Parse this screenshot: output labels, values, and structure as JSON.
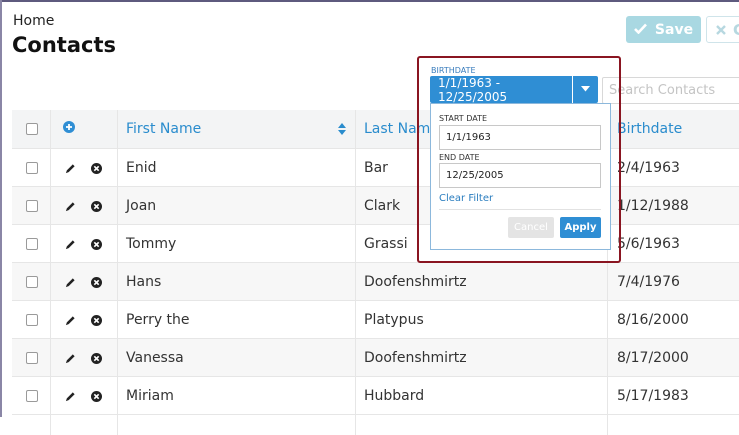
{
  "header": {
    "breadcrumb": "Home",
    "title": "Contacts",
    "save_label": "Save",
    "cancel_label": "C",
    "save_icon": "check-icon",
    "cancel_icon": "x-icon"
  },
  "search": {
    "placeholder": "Search Contacts"
  },
  "table": {
    "columns": [
      "First Name",
      "Last Name",
      "Birthdate"
    ],
    "first_name_sorted": true,
    "rows": [
      {
        "first": "Enid",
        "last": "Bar",
        "birthdate": "2/4/1963"
      },
      {
        "first": "Joan",
        "last": "Clark",
        "birthdate": "1/12/1988"
      },
      {
        "first": "Tommy",
        "last": "Grassi",
        "birthdate": "5/6/1963"
      },
      {
        "first": "Hans",
        "last": "Doofenshmirtz",
        "birthdate": "7/4/1976"
      },
      {
        "first": "Perry the",
        "last": "Platypus",
        "birthdate": "8/16/2000"
      },
      {
        "first": "Vanessa",
        "last": "Doofenshmirtz",
        "birthdate": "8/17/2000"
      },
      {
        "first": "Miriam",
        "last": "Hubbard",
        "birthdate": "5/17/1983"
      }
    ]
  },
  "filter": {
    "label": "BIRTHDATE",
    "range": "1/1/1963 - 12/25/2005",
    "start_label": "START DATE",
    "start_value": "1/1/1963",
    "end_label": "END DATE",
    "end_value": "12/25/2005",
    "clear": "Clear Filter",
    "cancel": "Cancel",
    "apply": "Apply"
  },
  "colors": {
    "accent": "#2f8ed4",
    "highlight_frame": "#8a1521",
    "save_button": "#a9d8e2"
  }
}
